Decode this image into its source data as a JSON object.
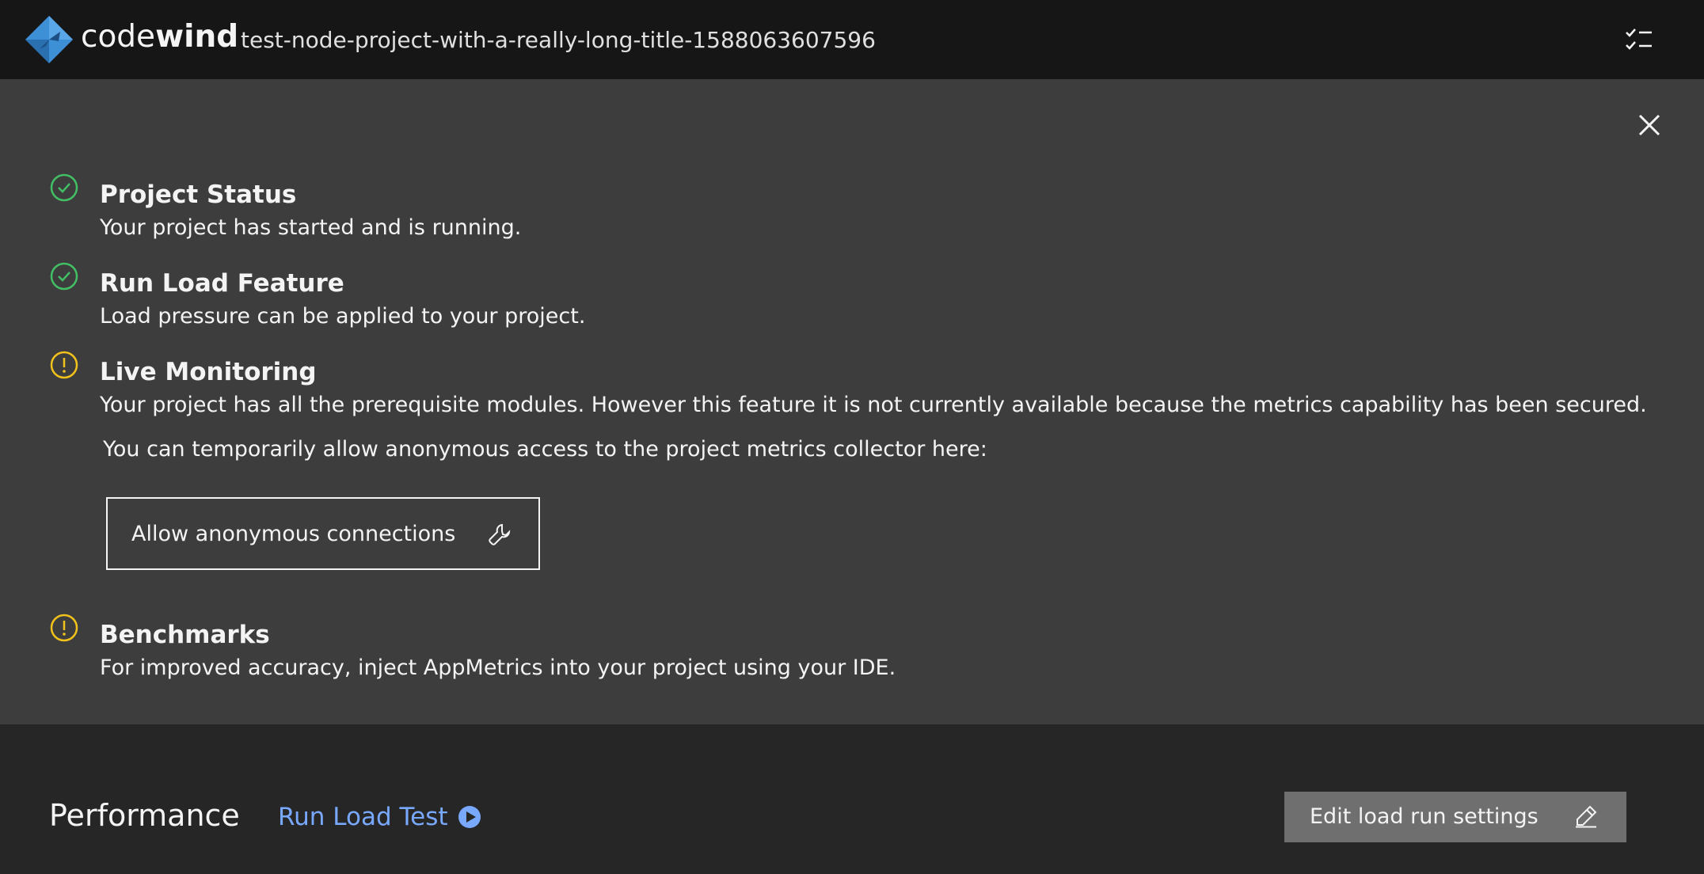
{
  "header": {
    "brand_light": "code",
    "brand_bold": "wind",
    "project_title": "test-node-project-with-a-really-long-title-1588063607596",
    "checklist_icon": "checklist-icon",
    "logo_icon": "codewind-logo"
  },
  "status_panel": {
    "close_icon": "close-icon",
    "items": [
      {
        "icon": "checkmark-outline-icon",
        "status": "success",
        "title": "Project Status",
        "description": "Your project has started and is running."
      },
      {
        "icon": "checkmark-outline-icon",
        "status": "success",
        "title": "Run Load Feature",
        "description": "Load pressure can be applied to your project."
      },
      {
        "icon": "warning-outline-icon",
        "status": "warning",
        "title": "Live Monitoring",
        "description": "Your project has all the prerequisite modules. However this feature it is not currently available because the metrics capability has been secured."
      },
      {
        "icon": "warning-outline-icon",
        "status": "warning",
        "title": "Benchmarks",
        "description": "For improved accuracy, inject AppMetrics into your project using your IDE."
      }
    ],
    "hint": "You can temporarily allow anonymous access to the project metrics collector here:",
    "allow_button": {
      "label": "Allow anonymous connections",
      "icon": "wrench-icon"
    }
  },
  "performance": {
    "title": "Performance",
    "run_load_test_label": "Run Load Test",
    "run_icon": "play-filled-icon",
    "edit_button_label": "Edit load run settings",
    "edit_icon": "edit-icon"
  },
  "colors": {
    "header_bg": "#161616",
    "panel_bg": "#3d3d3d",
    "page_bg": "#262626",
    "success": "#42be65",
    "warning": "#f1c21b",
    "link": "#78a9ff",
    "button_bg": "#6f6f6f"
  }
}
